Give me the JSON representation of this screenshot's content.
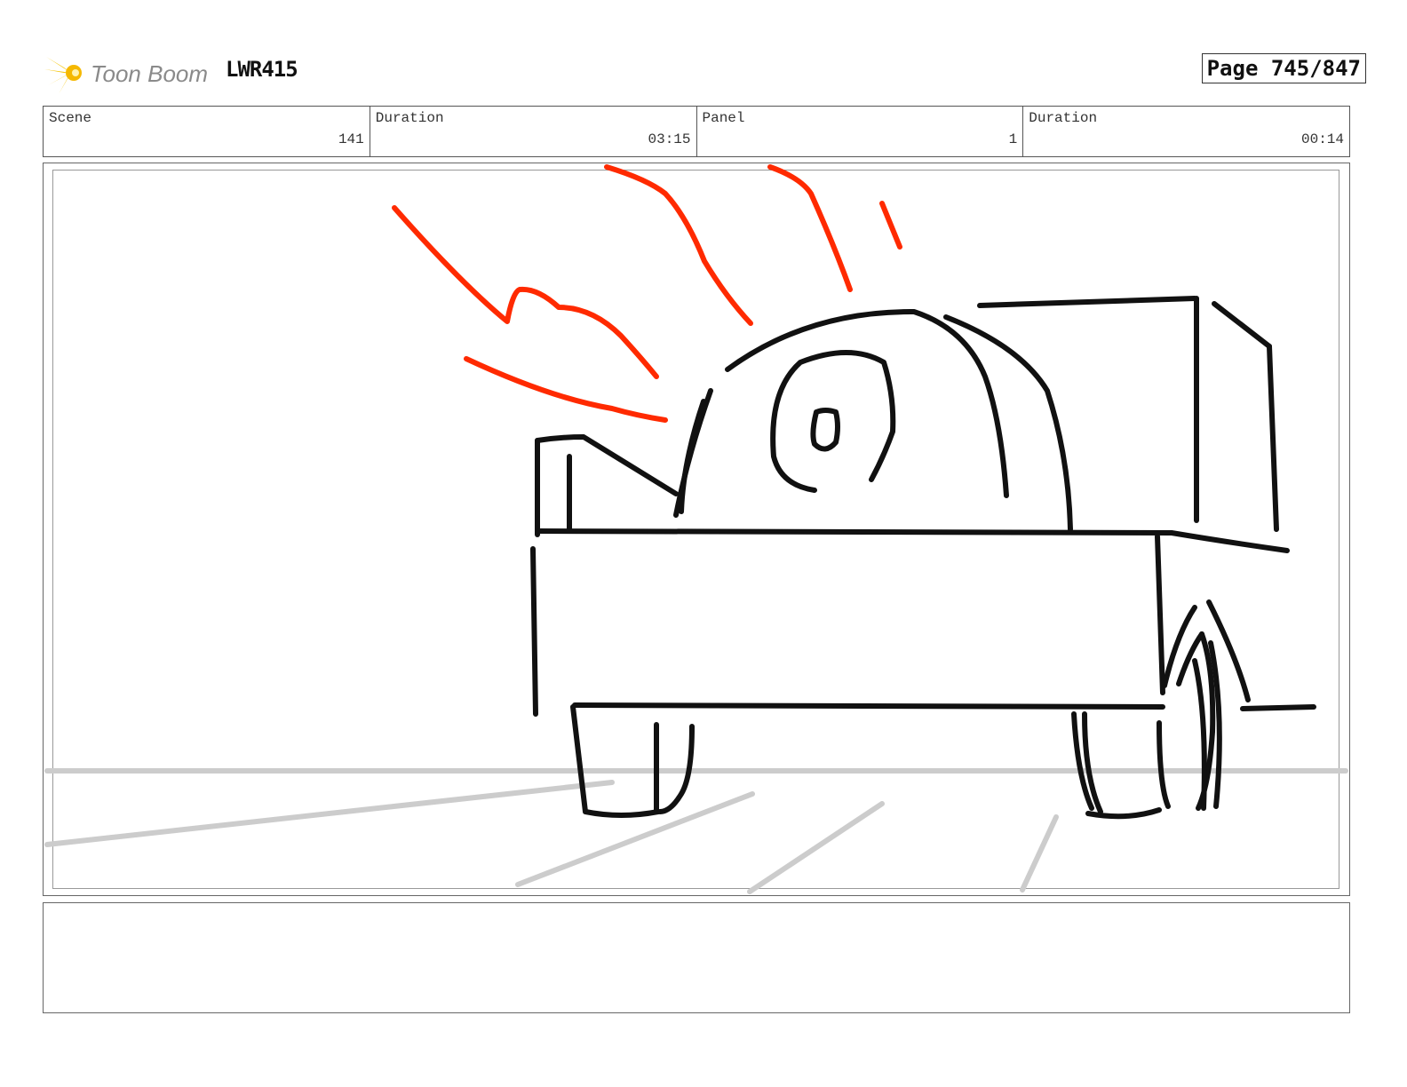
{
  "header": {
    "logo_text": "Toon Boom",
    "project": "LWR415",
    "page": "Page 745/847"
  },
  "info": {
    "scene_label": "Scene",
    "scene_value": "141",
    "duration_label": "Duration",
    "duration_value": "03:15",
    "panel_label": "Panel",
    "panel_value": "1",
    "panel_duration_label": "Duration",
    "panel_duration_value": "00:14"
  },
  "notes": {
    "text": ""
  },
  "colors": {
    "sketch_line": "#111111",
    "action_lines": "#ff2a00",
    "ground_lines": "#cccccc",
    "logo_star": "#f5c400"
  }
}
